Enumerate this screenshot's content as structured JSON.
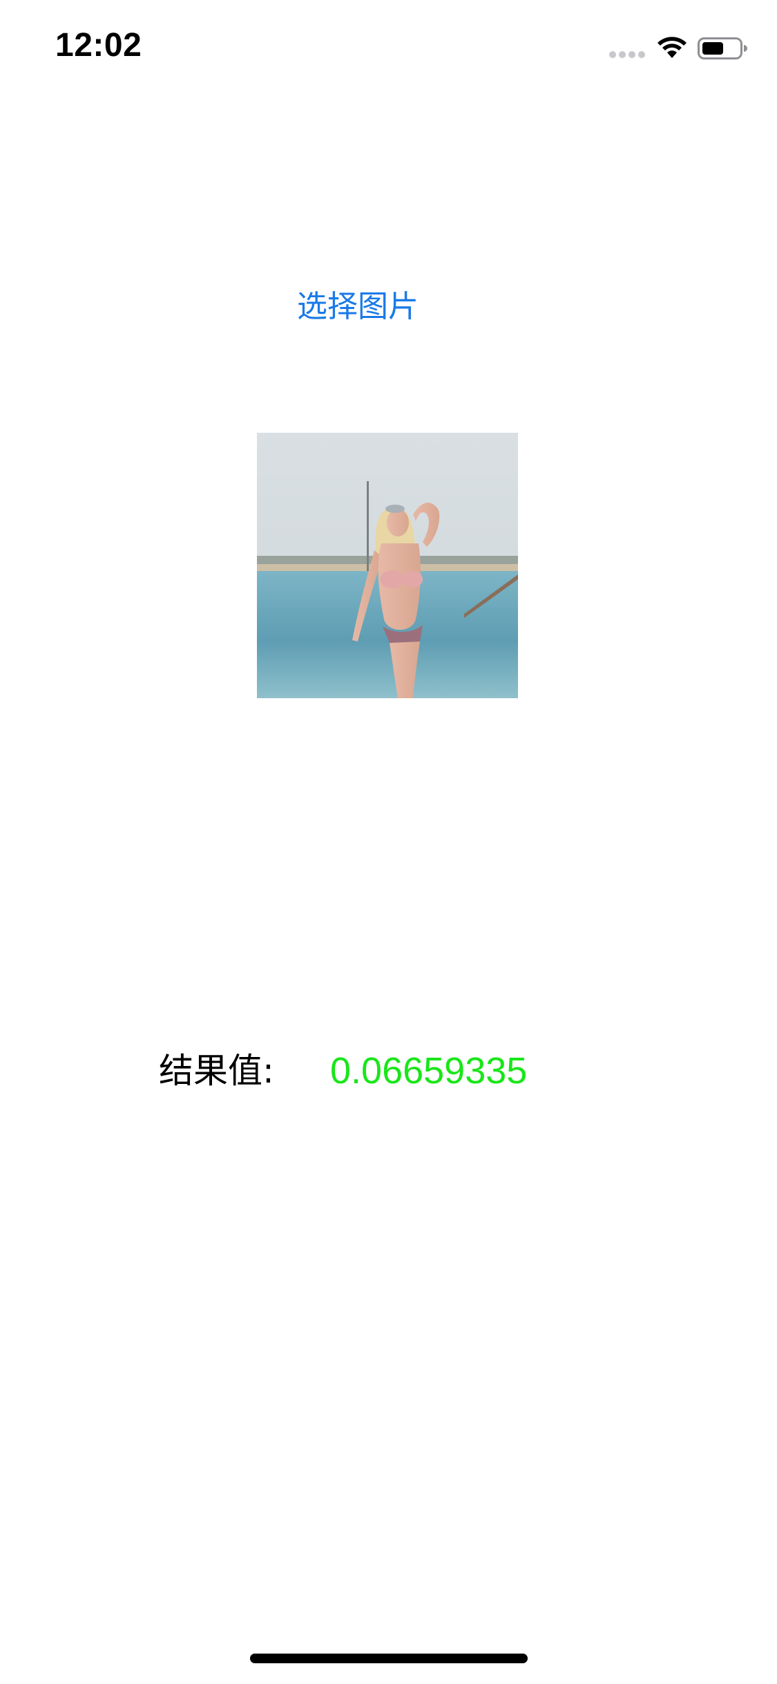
{
  "status_bar": {
    "time": "12:02",
    "icons": [
      "cellular-signal-icon",
      "wifi-icon",
      "battery-icon"
    ]
  },
  "main": {
    "select_button_label": "选择图片",
    "result_label": "结果值:",
    "result_value": "0.06659335"
  },
  "colors": {
    "link_blue": "#1a7ae8",
    "result_green": "#19e619"
  }
}
